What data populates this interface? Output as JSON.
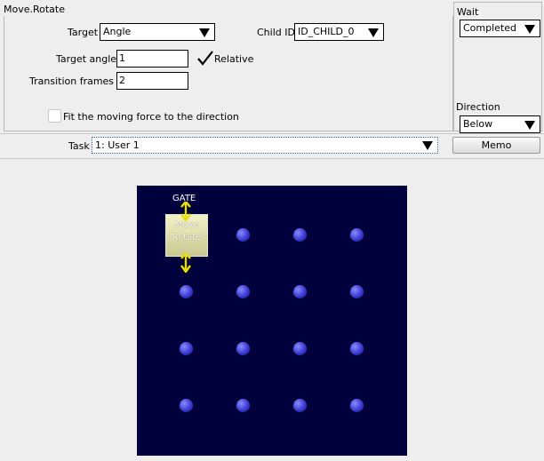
{
  "window": {
    "title": "Move.Rotate"
  },
  "form": {
    "target_label": "Target",
    "target_value": "Angle",
    "child_id_label": "Child ID",
    "child_id_value": "ID_CHILD_0",
    "target_angle_label": "Target angle",
    "target_angle_value": "1",
    "relative_label": "Relative",
    "relative_checked": true,
    "transition_frames_label": "Transition frames",
    "transition_frames_value": "2",
    "fit_label": "Fit the moving force to the direction",
    "fit_checked": false
  },
  "side": {
    "wait_label": "Wait",
    "wait_value": "Completed",
    "direction_label": "Direction",
    "direction_value": "Below"
  },
  "task": {
    "label": "Task",
    "value": "1: User 1",
    "memo_label": "Memo"
  },
  "graph": {
    "gate_label": "GATE",
    "node_line1": "Move",
    "node_line2": "Rotate",
    "colors": {
      "background": "#00003c",
      "dot": "#3a3ad0",
      "node": "#d8d8a8",
      "arrow": "#ffff00"
    }
  }
}
